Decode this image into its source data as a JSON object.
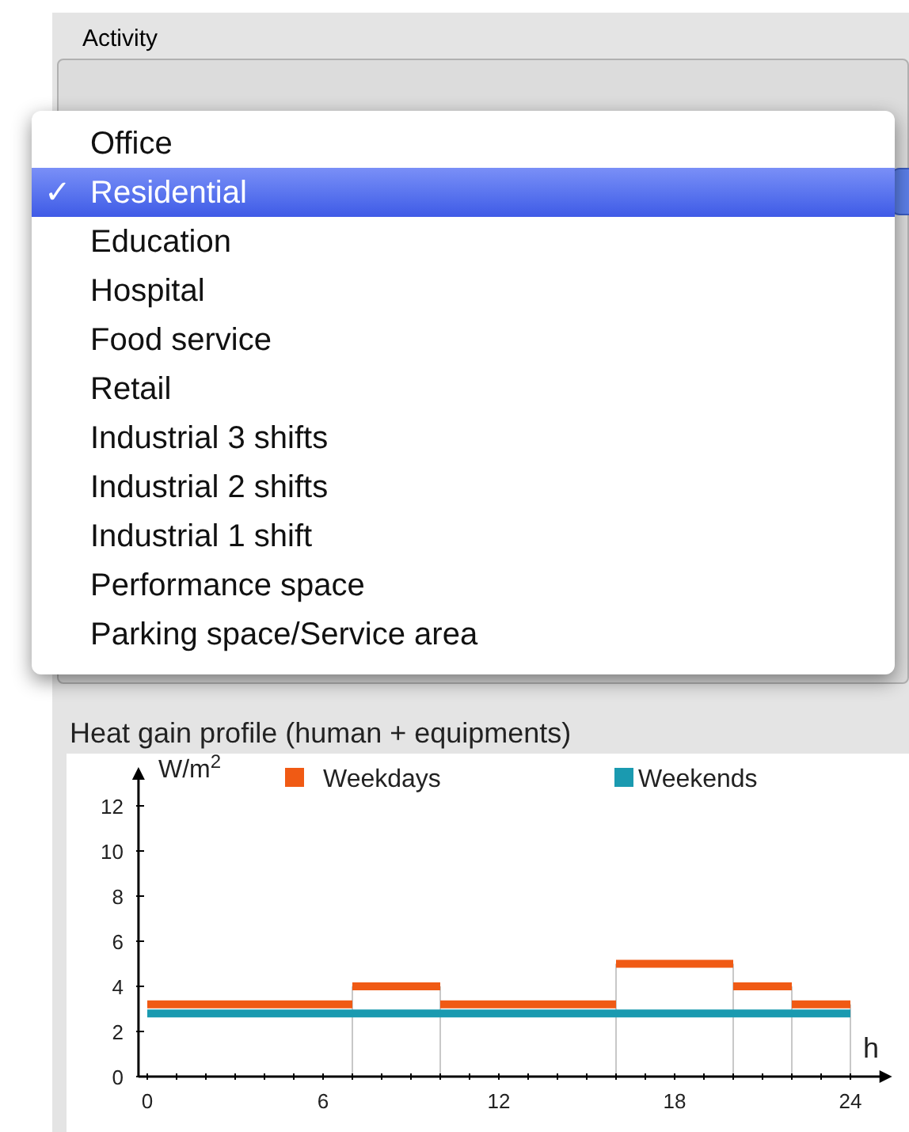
{
  "group_title": "Activity",
  "function_menu": {
    "items": [
      {
        "label": "Office",
        "selected": false
      },
      {
        "label": "Residential",
        "selected": true
      },
      {
        "label": "Education",
        "selected": false
      },
      {
        "label": "Hospital",
        "selected": false
      },
      {
        "label": "Food service",
        "selected": false
      },
      {
        "label": "Retail",
        "selected": false
      },
      {
        "label": "Industrial 3 shifts",
        "selected": false
      },
      {
        "label": "Industrial 2 shifts",
        "selected": false
      },
      {
        "label": "Industrial 1 shift",
        "selected": false
      },
      {
        "label": "Performance space",
        "selected": false
      },
      {
        "label": "Parking space/Service area",
        "selected": false
      }
    ],
    "check_mark": "✓"
  },
  "heat_gain": {
    "title": "Heat gain profile (human + equipments)",
    "chart_data": {
      "type": "line",
      "ylabel": "W/m$^{2}$",
      "xlabel": "h",
      "x": [
        0,
        7,
        7,
        10,
        10,
        16,
        16,
        20,
        20,
        22,
        22,
        24
      ],
      "series": [
        {
          "name": "Weekdays",
          "color": "#f05a14",
          "values": [
            3.2,
            3.2,
            4,
            4,
            3.2,
            3.2,
            5,
            5,
            4,
            4,
            3.2,
            3.2
          ]
        },
        {
          "name": "Weekends",
          "color": "#1a9ab0",
          "values": [
            2.8,
            2.8,
            2.8,
            2.8,
            2.8,
            2.8,
            2.8,
            2.8,
            2.8,
            2.8,
            2.8,
            2.8
          ]
        }
      ],
      "ref_lines": [
        {
          "axis": "x",
          "value": 7
        },
        {
          "axis": "x",
          "value": 10
        },
        {
          "axis": "x",
          "value": 16
        },
        {
          "axis": "x",
          "value": 20
        },
        {
          "axis": "x",
          "value": 22
        },
        {
          "axis": "x",
          "value": 24
        }
      ],
      "legend": "top",
      "xlim": [
        -0.3,
        25.1
      ],
      "ylim": [
        0,
        13.3
      ],
      "xticks": [
        0,
        6,
        12,
        18,
        24
      ],
      "yticks": [
        0,
        2,
        4,
        6,
        8,
        10,
        12
      ]
    }
  }
}
